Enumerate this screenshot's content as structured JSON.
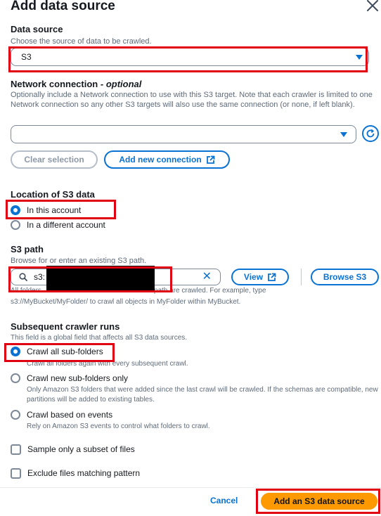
{
  "modal": {
    "title": "Add data source"
  },
  "data_source": {
    "label": "Data source",
    "description": "Choose the source of data to be crawled.",
    "value": "S3"
  },
  "network": {
    "label": "Network connection",
    "label_optional": "optional",
    "description": "Optionally include a Network connection to use with this S3 target. Note that each crawler is limited to one Network connection so any other S3 targets will also use the same connection (or none, if left blank).",
    "value": "",
    "clear_label": "Clear selection",
    "add_label": "Add new connection"
  },
  "location": {
    "label": "Location of S3 data",
    "options": [
      {
        "label": "In this account",
        "checked": true
      },
      {
        "label": "In a different account",
        "checked": false
      }
    ]
  },
  "s3path": {
    "label": "S3 path",
    "description": "Browse for or enter an existing S3 path.",
    "value": "s3:",
    "help_start": "All folders",
    "help_end": "path are crawled. For example, type",
    "help_line2": "s3://MyBucket/MyFolder/ to crawl all objects in MyFolder within MyBucket.",
    "view_label": "View",
    "browse_label": "Browse S3"
  },
  "subsequent": {
    "label": "Subsequent crawler runs",
    "description": "This field is a global field that affects all S3 data sources.",
    "options": [
      {
        "label": "Crawl all sub-folders",
        "desc": "Crawl all folders again with every subsequent crawl.",
        "checked": true
      },
      {
        "label": "Crawl new sub-folders only",
        "desc": "Only Amazon S3 folders that were added since the last crawl will be crawled. If the schemas are compatible, new partitions will be added to existing tables.",
        "checked": false
      },
      {
        "label": "Crawl based on events",
        "desc": "Rely on Amazon S3 events to control what folders to crawl.",
        "checked": false
      }
    ]
  },
  "checkboxes": [
    {
      "label": "Sample only a subset of files",
      "checked": false
    },
    {
      "label": "Exclude files matching pattern",
      "checked": false
    }
  ],
  "footer": {
    "cancel_label": "Cancel",
    "submit_label": "Add an S3 data source"
  },
  "colors": {
    "accent": "#0972d3",
    "primary_button": "#ff9900",
    "highlight": "#e00012"
  }
}
